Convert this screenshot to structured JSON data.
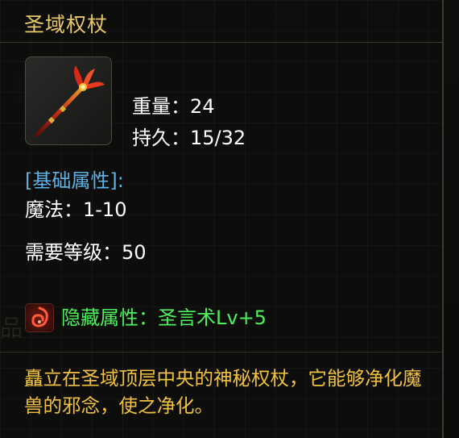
{
  "item": {
    "name": "圣域权杖",
    "weight_text": "重量：24",
    "durability_text": "持久：15/32"
  },
  "base_attributes": {
    "header": "[基础属性]:",
    "magic_text": "魔法：1-10"
  },
  "requirement": {
    "level_text": "需要等级：50"
  },
  "hidden_attribute": {
    "text": "隐藏属性：圣言术Lv+5"
  },
  "description": "矗立在圣域顶层中央的神秘权杖，它能够净化魔兽的邪念，使之净化。",
  "colors": {
    "title": "#e8c76a",
    "section_header": "#5fb2e3",
    "stat": "#ffffff",
    "hidden_attribute": "#4ef05a",
    "description": "#f0c040"
  },
  "icons": {
    "item": "red-scepter-icon",
    "hidden_attribute": "holy-word-skill-icon"
  }
}
